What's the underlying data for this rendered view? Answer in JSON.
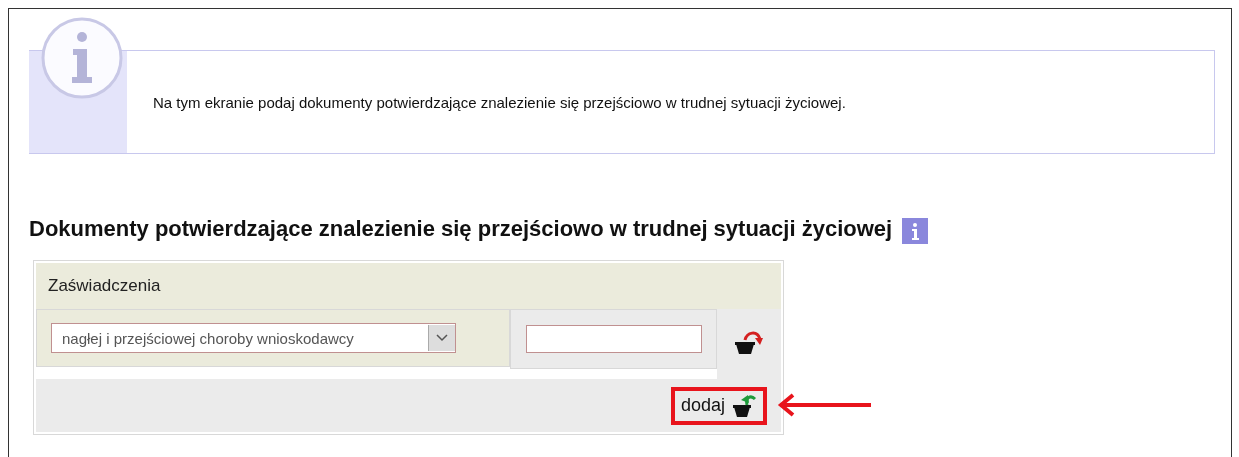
{
  "info_box": {
    "text": "Na tym ekranie podaj dokumenty potwierdzające znalezienie się przejściowo w trudnej sytuacji życiowej."
  },
  "section": {
    "heading": "Dokumenty potwierdzające znalezienie się przejściowo w trudnej sytuacji życiowej"
  },
  "table": {
    "header": "Zaświadczenia",
    "rows": [
      {
        "document_type": "nagłej i przejściowej choroby wnioskodawcy"
      }
    ],
    "add_button": {
      "label": "dodaj",
      "highlighted": true
    }
  }
}
